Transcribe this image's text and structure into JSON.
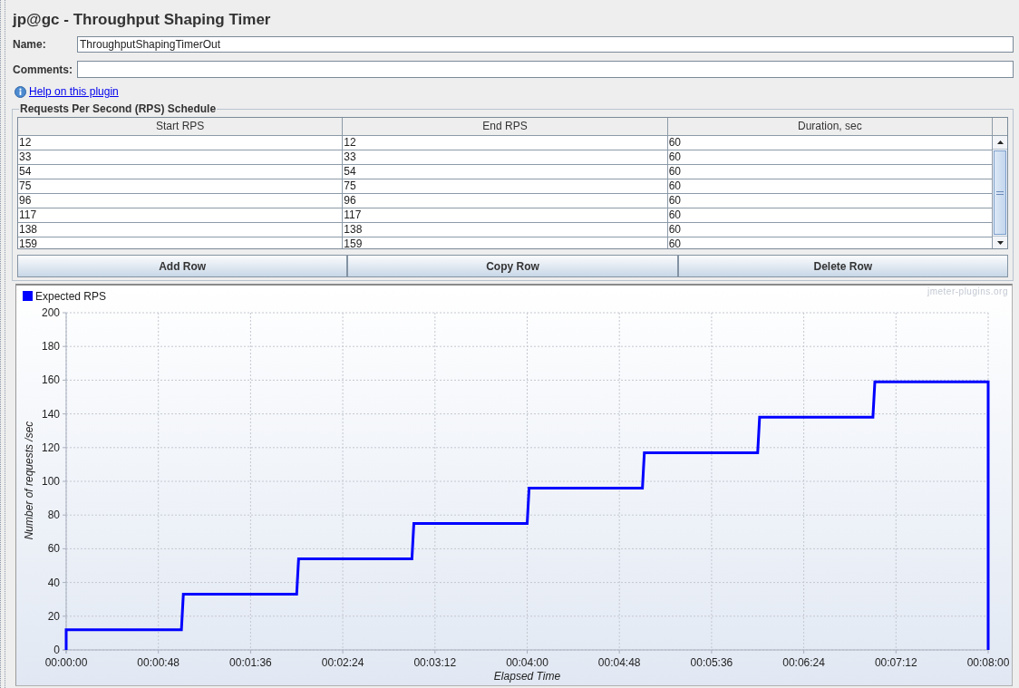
{
  "title": "jp@gc - Throughput Shaping Timer",
  "form": {
    "fields": [
      {
        "label": "Name:",
        "value": "ThroughputShapingTimerOut"
      },
      {
        "label": "Comments:"
      }
    ]
  },
  "help_link": "Help on this plugin",
  "schedule": {
    "title": "Requests Per Second (RPS) Schedule",
    "columns": [
      "Start RPS",
      "End RPS",
      "Duration, sec"
    ],
    "rows": [
      [
        "12",
        "12",
        "60"
      ],
      [
        "33",
        "33",
        "60"
      ],
      [
        "54",
        "54",
        "60"
      ],
      [
        "75",
        "75",
        "60"
      ],
      [
        "96",
        "96",
        "60"
      ],
      [
        "117",
        "117",
        "60"
      ],
      [
        "138",
        "138",
        "60"
      ],
      [
        "159",
        "159",
        "60"
      ]
    ],
    "buttons": [
      "Add Row",
      "Copy Row",
      "Delete Row"
    ]
  },
  "chart": {
    "credit": "jmeter-plugins.org",
    "chart_data": {
      "type": "line",
      "grid": true,
      "xlabel": "Elapsed Time",
      "ylabel": "Number of requests /sec",
      "x": [
        0,
        0,
        60,
        61,
        120,
        121,
        180,
        181,
        240,
        241,
        300,
        301,
        360,
        361,
        420,
        421,
        480,
        480
      ],
      "series": [
        {
          "name": "Expected RPS",
          "color": "#0000ff",
          "values": [
            0,
            12,
            12,
            33,
            33,
            54,
            54,
            75,
            75,
            96,
            96,
            117,
            117,
            138,
            138,
            159,
            159,
            0
          ]
        }
      ],
      "xlim": [
        0,
        480
      ],
      "ylim": [
        0,
        200
      ],
      "xticks": [
        {
          "value": 0,
          "label": "00:00:00"
        },
        {
          "value": 48,
          "label": "00:00:48"
        },
        {
          "value": 96,
          "label": "00:01:36"
        },
        {
          "value": 144,
          "label": "00:02:24"
        },
        {
          "value": 192,
          "label": "00:03:12"
        },
        {
          "value": 240,
          "label": "00:04:00"
        },
        {
          "value": 288,
          "label": "00:04:48"
        },
        {
          "value": 336,
          "label": "00:05:36"
        },
        {
          "value": 384,
          "label": "00:06:24"
        },
        {
          "value": 432,
          "label": "00:07:12"
        },
        {
          "value": 480,
          "label": "00:08:00"
        }
      ],
      "yticks": [
        0,
        20,
        40,
        60,
        80,
        100,
        120,
        140,
        160,
        180,
        200
      ]
    }
  }
}
